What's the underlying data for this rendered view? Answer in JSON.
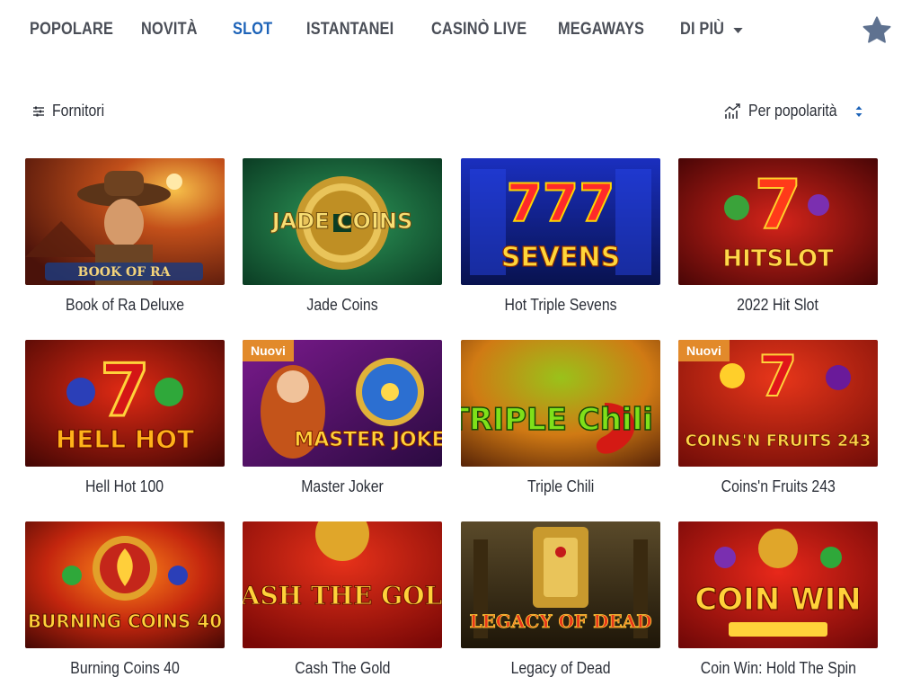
{
  "nav": {
    "items": [
      {
        "label": "POPOLARE",
        "active": false
      },
      {
        "label": "NOVITÀ",
        "active": false
      },
      {
        "label": "SLOT",
        "active": true
      },
      {
        "label": "ISTANTANEI",
        "active": false
      },
      {
        "label": "CASINÒ LIVE",
        "active": false
      },
      {
        "label": "MEGAWAYS",
        "active": false
      }
    ],
    "more_label": "DI PIÙ",
    "accent_color": "#1d63b8"
  },
  "toolbar": {
    "filter_label": "Fornitori",
    "sort_label": "Per popolarità"
  },
  "games": [
    {
      "title": "Book of Ra Deluxe",
      "art_text": "BOOK OF RA"
    },
    {
      "title": "Jade Coins",
      "art_text": "JADE COINS"
    },
    {
      "title": "Hot Triple Sevens",
      "art_text": "SEVENS"
    },
    {
      "title": "2022 Hit Slot",
      "art_text": "HITSLOT"
    },
    {
      "title": "Hell Hot 100",
      "art_text": "HELL HOT"
    },
    {
      "title": "Master Joker",
      "art_text": "MASTER JOKER",
      "badge": "Nuovi"
    },
    {
      "title": "Triple Chili",
      "art_text": "TRIPLE Chili"
    },
    {
      "title": "Coins'n Fruits 243",
      "art_text": "COINS'N FRUITS 243",
      "badge": "Nuovi"
    },
    {
      "title": "Burning Coins 40",
      "art_text": "BURNING COINS 40"
    },
    {
      "title": "Cash The Gold",
      "art_text": "CASH THE GOLD"
    },
    {
      "title": "Legacy of Dead",
      "art_text": "LEGACY OF DEAD"
    },
    {
      "title": "Coin Win: Hold The Spin",
      "art_text": "COIN WIN"
    }
  ]
}
